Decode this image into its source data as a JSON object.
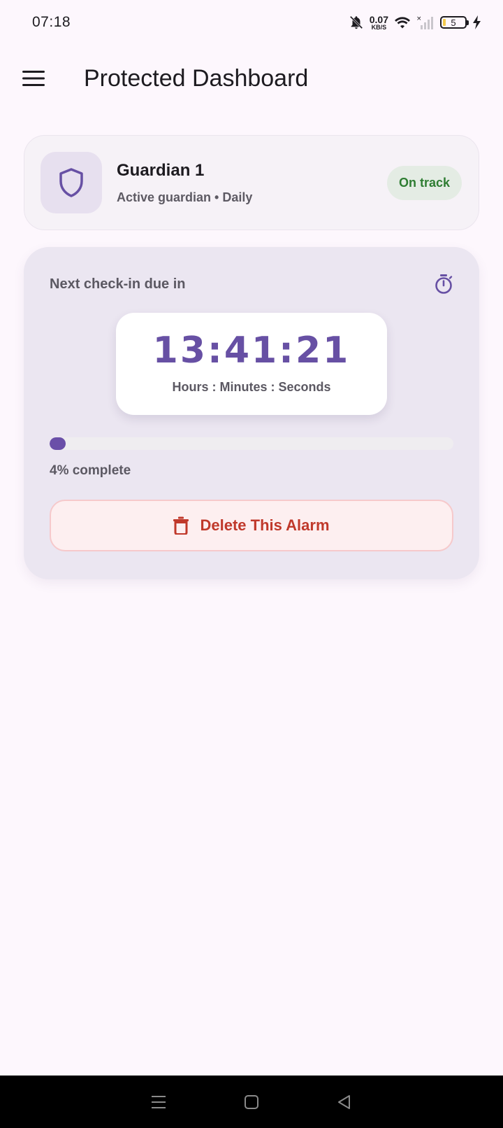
{
  "status_bar": {
    "time": "07:18",
    "net_speed_value": "0.07",
    "net_speed_unit": "KB/S",
    "battery_level": "5",
    "icons": [
      "bell-off-icon",
      "wifi-icon",
      "signal-off-icon",
      "battery-icon",
      "charging-icon"
    ]
  },
  "app_bar": {
    "title": "Protected Dashboard",
    "menu_icon": "menu-icon"
  },
  "guardian": {
    "name": "Guardian 1",
    "subtitle": "Active guardian • Daily",
    "status": "On track",
    "icon": "shield-icon"
  },
  "countdown": {
    "label": "Next check-in due in",
    "timer": "13:41:21",
    "caption": "Hours : Minutes : Seconds",
    "progress_percent": 4,
    "progress_text": "4% complete",
    "delete_label": "Delete This Alarm",
    "timer_icon": "stopwatch-icon",
    "delete_icon": "trash-icon"
  },
  "nav_bar": {
    "items": [
      "recents-icon",
      "home-icon",
      "back-icon"
    ]
  },
  "colors": {
    "accent": "#6750a4",
    "success": "#2e7d32",
    "danger": "#c0392b",
    "background": "#fdf7fd"
  }
}
